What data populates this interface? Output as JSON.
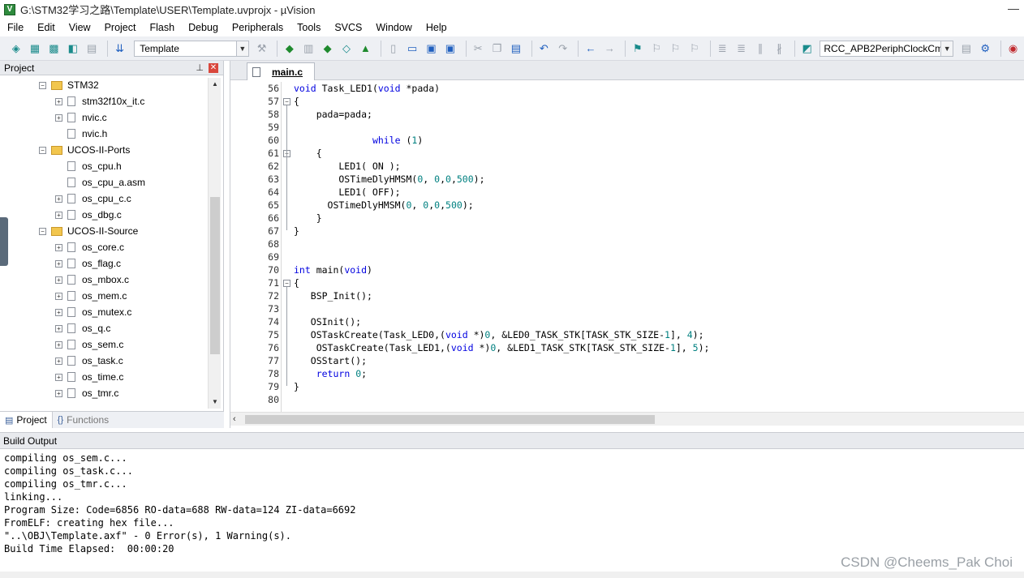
{
  "window": {
    "title": "G:\\STM32学习之路\\Template\\USER\\Template.uvprojx - µVision",
    "app_icon_letter": "V",
    "control": "—"
  },
  "menu": [
    "File",
    "Edit",
    "View",
    "Project",
    "Flash",
    "Debug",
    "Peripherals",
    "Tools",
    "SVCS",
    "Window",
    "Help"
  ],
  "toolbar": {
    "target_label": "Template",
    "function_label": "RCC_APB2PeriphClockCm"
  },
  "project_panel": {
    "title": "Project",
    "pin_glyph": "⊥",
    "close_glyph": "✕",
    "tree": [
      {
        "label": "STM32",
        "type": "folder",
        "expanded": true,
        "level": 0
      },
      {
        "label": "stm32f10x_it.c",
        "type": "file",
        "expander": true,
        "level": 1
      },
      {
        "label": "nvic.c",
        "type": "file",
        "expander": true,
        "level": 1
      },
      {
        "label": "nvic.h",
        "type": "file",
        "expander": false,
        "level": 1
      },
      {
        "label": "UCOS-II-Ports",
        "type": "folder",
        "expanded": true,
        "level": 0
      },
      {
        "label": "os_cpu.h",
        "type": "file",
        "expander": false,
        "level": 1
      },
      {
        "label": "os_cpu_a.asm",
        "type": "file",
        "expander": false,
        "level": 1
      },
      {
        "label": "os_cpu_c.c",
        "type": "file",
        "expander": true,
        "level": 1
      },
      {
        "label": "os_dbg.c",
        "type": "file",
        "expander": true,
        "level": 1
      },
      {
        "label": "UCOS-II-Source",
        "type": "folder",
        "expanded": true,
        "level": 0
      },
      {
        "label": "os_core.c",
        "type": "file",
        "expander": true,
        "level": 1
      },
      {
        "label": "os_flag.c",
        "type": "file",
        "expander": true,
        "level": 1
      },
      {
        "label": "os_mbox.c",
        "type": "file",
        "expander": true,
        "level": 1
      },
      {
        "label": "os_mem.c",
        "type": "file",
        "expander": true,
        "level": 1
      },
      {
        "label": "os_mutex.c",
        "type": "file",
        "expander": true,
        "level": 1
      },
      {
        "label": "os_q.c",
        "type": "file",
        "expander": true,
        "level": 1
      },
      {
        "label": "os_sem.c",
        "type": "file",
        "expander": true,
        "level": 1
      },
      {
        "label": "os_task.c",
        "type": "file",
        "expander": true,
        "level": 1
      },
      {
        "label": "os_time.c",
        "type": "file",
        "expander": true,
        "level": 1
      },
      {
        "label": "os_tmr.c",
        "type": "file",
        "expander": true,
        "level": 1
      }
    ],
    "tabs": [
      {
        "label": "Project",
        "icon": "▤"
      },
      {
        "label": "Functions",
        "icon": "{}"
      }
    ]
  },
  "editor": {
    "tab_label": "main.c",
    "lines": [
      {
        "n": "56",
        "text": "void Task_LED1(void *pada)",
        "fold": ""
      },
      {
        "n": "57",
        "text": "{",
        "fold": "⊟"
      },
      {
        "n": "58",
        "text": "    pada=pada;",
        "fold": ""
      },
      {
        "n": "59",
        "text": "",
        "fold": ""
      },
      {
        "n": "60",
        "text": "              while (1)",
        "fold": ""
      },
      {
        "n": "61",
        "text": "    {",
        "fold": "⊟"
      },
      {
        "n": "62",
        "text": "        LED1( ON );",
        "fold": ""
      },
      {
        "n": "63",
        "text": "        OSTimeDlyHMSM(0, 0,0,500);",
        "fold": ""
      },
      {
        "n": "64",
        "text": "        LED1( OFF);",
        "fold": ""
      },
      {
        "n": "65",
        "text": "      OSTimeDlyHMSM(0, 0,0,500);",
        "fold": ""
      },
      {
        "n": "66",
        "text": "    }",
        "fold": ""
      },
      {
        "n": "67",
        "text": "}",
        "fold": ""
      },
      {
        "n": "68",
        "text": "",
        "fold": ""
      },
      {
        "n": "69",
        "text": "",
        "fold": ""
      },
      {
        "n": "70",
        "text": "int main(void)",
        "fold": ""
      },
      {
        "n": "71",
        "text": "{",
        "fold": "⊟"
      },
      {
        "n": "72",
        "text": "   BSP_Init();",
        "fold": ""
      },
      {
        "n": "73",
        "text": "",
        "fold": ""
      },
      {
        "n": "74",
        "text": "   OSInit();",
        "fold": ""
      },
      {
        "n": "75",
        "text": "   OSTaskCreate(Task_LED0,(void *)0, &LED0_TASK_STK[TASK_STK_SIZE-1], 4);",
        "fold": ""
      },
      {
        "n": "76",
        "text": "    OSTaskCreate(Task_LED1,(void *)0, &LED1_TASK_STK[TASK_STK_SIZE-1], 5);",
        "fold": ""
      },
      {
        "n": "77",
        "text": "   OSStart();",
        "fold": ""
      },
      {
        "n": "78",
        "text": "    return 0;",
        "fold": ""
      },
      {
        "n": "79",
        "text": "}",
        "fold": ""
      },
      {
        "n": "80",
        "text": "",
        "fold": ""
      }
    ]
  },
  "build_output": {
    "title": "Build Output",
    "lines": [
      "compiling os_sem.c...",
      "compiling os_task.c...",
      "compiling os_tmr.c...",
      "linking...",
      "Program Size: Code=6856 RO-data=688 RW-data=124 ZI-data=6692",
      "FromELF: creating hex file...",
      "\"..\\OBJ\\Template.axf\" - 0 Error(s), 1 Warning(s).",
      "Build Time Elapsed:  00:00:20"
    ]
  },
  "watermark": "CSDN @Cheems_Pak Choi",
  "colors": {
    "keyword": "#0000e0",
    "number": "#008080"
  }
}
